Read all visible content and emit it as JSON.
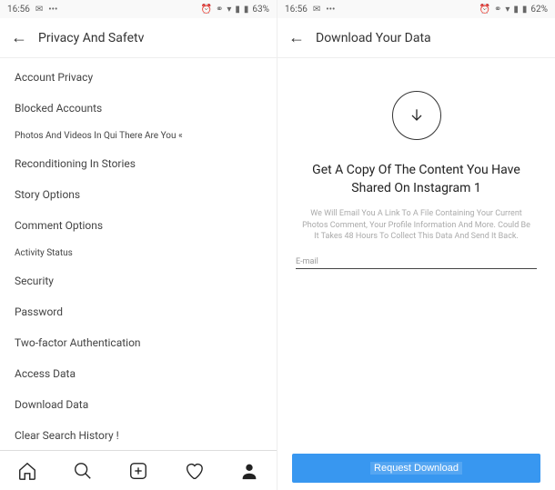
{
  "status": {
    "time_left": "16:56",
    "battery_left": "63%",
    "time_right": "16:56",
    "battery_right": "62%"
  },
  "left": {
    "title": "Privacy And Safetv",
    "items": [
      "Account Privacy",
      "Blocked Accounts",
      "Photos And Videos In Qui There Are You «",
      "Reconditioning In Stories",
      "Story Options",
      "Comment Options",
      "Activity Status",
      "Security",
      "Password",
      "Two-factor Authentication",
      "Access Data",
      "Download Data",
      "Clear Search History !"
    ]
  },
  "right": {
    "title": "Download Your Data",
    "heading": "Get A Copy Of The Content You Have Shared On Instagram 1",
    "description": "We Will Email You A Link To A File Containing Your Current Photos Comment, Your Profile Information And More. Could Be It Takes 48 Hours To Collect This Data And Send It Back.",
    "email_label": "E-mail",
    "button": "Request Download"
  }
}
